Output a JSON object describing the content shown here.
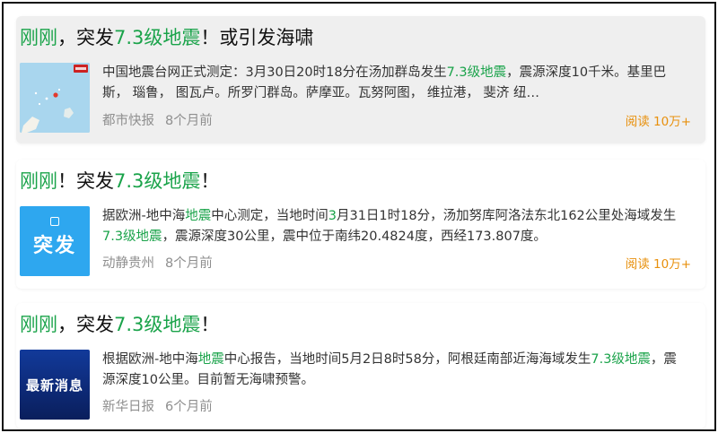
{
  "articles": [
    {
      "title": {
        "p1": "刚刚",
        "p2": "，突发",
        "p3": "7.3级地震",
        "p4": "！或引发海啸"
      },
      "summary": {
        "s1": "中国地震台网正式测定：3月30日20时18分在汤加群岛发生",
        "s2": "7.3级地震",
        "s3": "，震源深度10千米。基里巴斯， 瑙鲁， 图瓦卢。所罗门群岛。萨摩亚。瓦努阿图， 维拉港， 斐济 纽…"
      },
      "source": "都市快报",
      "time": "8个月前",
      "reads": "阅读 10万+",
      "thumb_type": "map"
    },
    {
      "title": {
        "p1": "刚刚",
        "p2": "！突发",
        "p3": "7.3级地震",
        "p4": "！"
      },
      "summary": {
        "s1": "据欧洲-地中海",
        "s2": "地震",
        "s3": "中心测定，当地时间",
        "s4": "3",
        "s5": "月31日1时18分，汤加努库阿洛法东北162公里处海域发生",
        "s6": "7.3级地震",
        "s7": "，震源深度30公里，震中位于南纬20.4824度，西经173.807度。"
      },
      "source": "动静贵州",
      "time": "8个月前",
      "reads": "阅读 10万+",
      "thumb_type": "badge",
      "thumb_text": "突发"
    },
    {
      "title": {
        "p1": "刚刚",
        "p2": "，突发",
        "p3": "7.3级地震",
        "p4": "！"
      },
      "summary": {
        "s1": "根据欧洲-地中海",
        "s2": "地震",
        "s3": "中心报告，当地时间5月2日8时58分，阿根廷南部近海海域发生",
        "s4": "7.3级地震",
        "s5": "，震源深度10公里。目前暂无海啸预警。"
      },
      "source": "新华日报",
      "time": "6个月前",
      "thumb_type": "banner",
      "thumb_text": "最新消息"
    }
  ],
  "colors": {
    "highlight": "#1aa34a",
    "reads": "#e8900c",
    "meta": "#8f8f8f",
    "map_sea": "#9fd0ea",
    "badge_blue": "#2ea7ef",
    "banner_navy": "#0d2a78"
  }
}
